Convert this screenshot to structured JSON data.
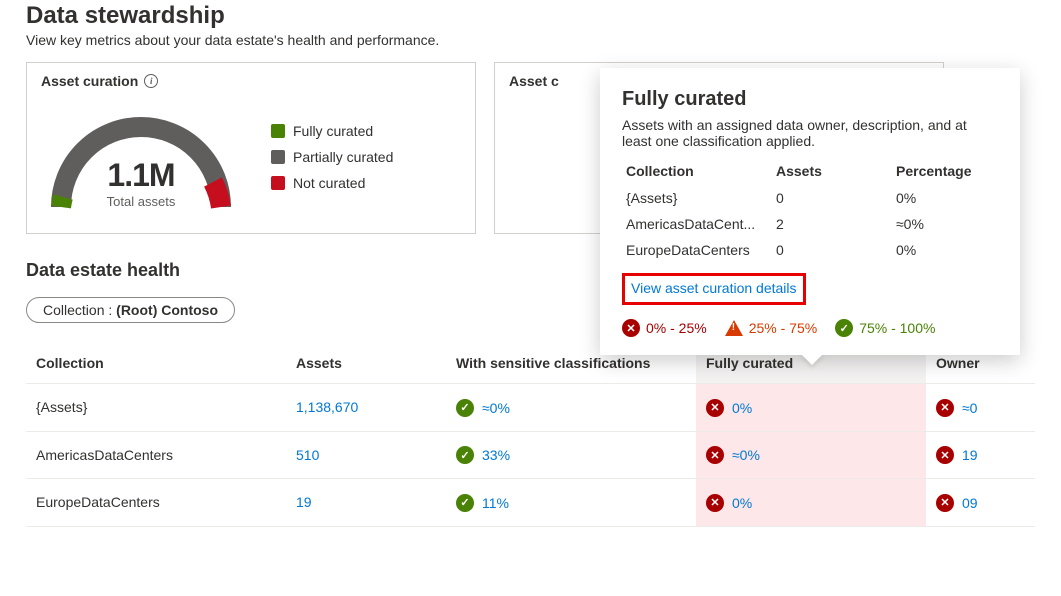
{
  "header": {
    "title": "Data stewardship",
    "subtitle": "View key metrics about your data estate's health and performance."
  },
  "cards": {
    "curation": {
      "title": "Asset curation",
      "total_value": "1.1M",
      "total_label": "Total assets",
      "legend": {
        "fully": "Fully curated",
        "partially": "Partially curated",
        "not": "Not curated"
      },
      "colors": {
        "fully": "#498205",
        "partially": "#605e5c",
        "not": "#c50f1f"
      }
    },
    "second": {
      "title_prefix": "Asset c"
    }
  },
  "health": {
    "title": "Data estate health",
    "filter_label": "Collection : ",
    "filter_value": "(Root) Contoso",
    "columns": {
      "collection": "Collection",
      "assets": "Assets",
      "sensitive": "With sensitive classifications",
      "fully": "Fully curated",
      "owner": "Owner"
    },
    "rows": [
      {
        "collection": "{Assets}",
        "assets": "1,138,670",
        "sensitive": "≈0%",
        "sensitive_status": "ok",
        "fully": "0%",
        "fully_status": "err",
        "owner": "≈0",
        "owner_status": "err"
      },
      {
        "collection": "AmericasDataCenters",
        "assets": "510",
        "sensitive": "33%",
        "sensitive_status": "ok",
        "fully": "≈0%",
        "fully_status": "err",
        "owner": "19",
        "owner_status": "err"
      },
      {
        "collection": "EuropeDataCenters",
        "assets": "19",
        "sensitive": "11%",
        "sensitive_status": "ok",
        "fully": "0%",
        "fully_status": "err",
        "owner": "09",
        "owner_status": "err"
      }
    ]
  },
  "popover": {
    "title": "Fully curated",
    "desc": "Assets with an assigned data owner, description, and at least one classification applied.",
    "cols": {
      "collection": "Collection",
      "assets": "Assets",
      "percentage": "Percentage"
    },
    "rows": [
      {
        "collection": "{Assets}",
        "assets": "0",
        "percentage": "0%"
      },
      {
        "collection": "AmericasDataCent...",
        "assets": "2",
        "percentage": "≈0%"
      },
      {
        "collection": "EuropeDataCenters",
        "assets": "0",
        "percentage": "0%"
      }
    ],
    "view_link": "View asset curation details",
    "scale": {
      "low": "0% - 25%",
      "mid": "25% - 75%",
      "high": "75% - 100%"
    }
  },
  "chart_data": {
    "type": "pie",
    "title": "Asset curation",
    "total": "1.1M",
    "series": [
      {
        "name": "Fully curated",
        "value_pct": 1,
        "color": "#498205"
      },
      {
        "name": "Partially curated",
        "value_pct": 93,
        "color": "#605e5c"
      },
      {
        "name": "Not curated",
        "value_pct": 6,
        "color": "#c50f1f"
      }
    ]
  }
}
